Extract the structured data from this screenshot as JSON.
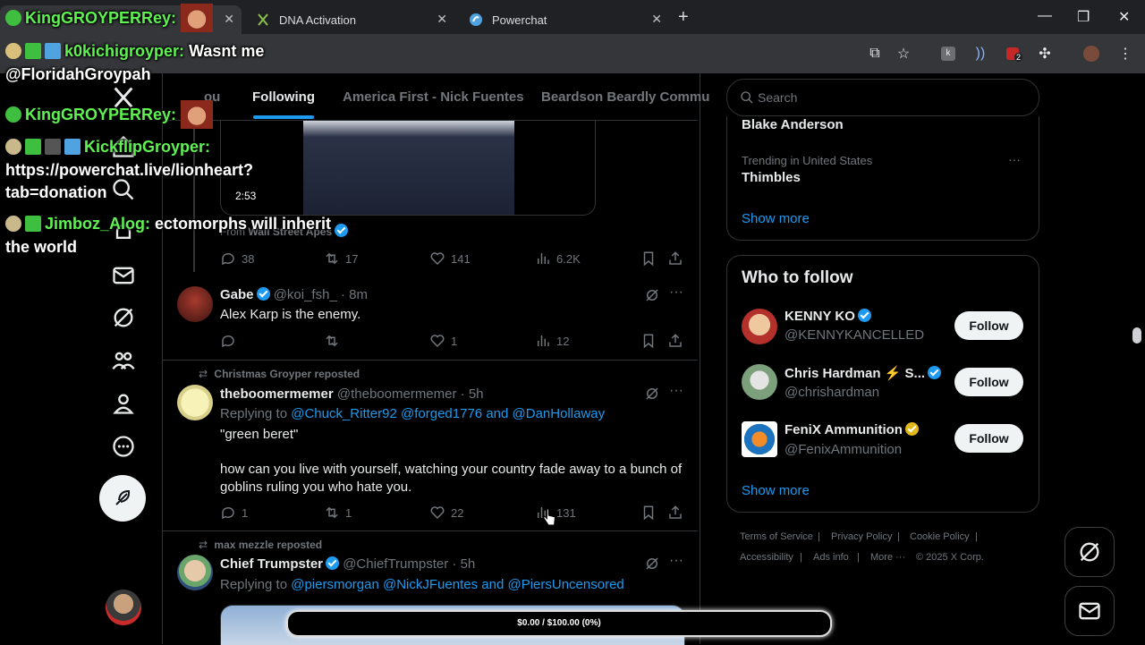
{
  "browser": {
    "tabs": [
      {
        "label": ""
      },
      {
        "label": "DNA Activation"
      },
      {
        "label": "Powerchat"
      }
    ],
    "extension_badge": "2"
  },
  "timeline": {
    "tabs": [
      "ou",
      "Following",
      "America First - Nick Fuentes",
      "Beardson Beardly Commu"
    ],
    "video_post": {
      "duration": "2:53",
      "from_label": "From",
      "from_account": "Wall Street Apes",
      "replies": "38",
      "reposts": "17",
      "likes": "141",
      "views": "6.2K"
    },
    "reply_post": {
      "name": "Gabe",
      "handle": "@koi_fsh_",
      "time": "· 8m",
      "text": "Alex Karp is the enemy.",
      "replies": "",
      "reposts": "",
      "likes": "1",
      "views": "12"
    },
    "boomer_post": {
      "repost_by": "Christmas Groyper reposted",
      "name": "theboomermemer",
      "handle": "@theboomermemer",
      "time": "· 5h",
      "replying_label": "Replying to",
      "reply_to_1": "@Chuck_Ritter92",
      "reply_to_2": "@forged1776",
      "and_label": "and",
      "reply_to_3": "@DanHollaway",
      "line1": "\"green beret\"",
      "line2": "how can you live with yourself, watching your country fade away to a bunch of goblins ruling you who hate you.",
      "replies": "1",
      "reposts": "1",
      "likes": "22",
      "views": "131"
    },
    "trumpster_post": {
      "repost_by": "max mezzle reposted",
      "name": "Chief Trumpster",
      "handle": "@ChiefTrumpster",
      "time": "· 5h",
      "replying_label": "Replying to",
      "reply_to_1": "@piersmorgan",
      "reply_to_2": "@NickJFuentes",
      "and_label": "and",
      "reply_to_3": "@PiersUncensored"
    }
  },
  "sidebar": {
    "search_placeholder": "Search",
    "trend_top": "Blake Anderson",
    "trend_context": "Trending in United States",
    "trend_name": "Thimbles",
    "show_more": "Show more",
    "who_to_follow_title": "Who to follow",
    "suggestions": [
      {
        "name": "KENNY KO",
        "handle": "@KENNYKANCELLED",
        "button": "Follow"
      },
      {
        "name": "Chris Hardman ⚡ S...",
        "handle": "@chrishardman",
        "button": "Follow"
      },
      {
        "name": "FeniX Ammunition",
        "handle": "@FenixAmmunition",
        "button": "Follow"
      }
    ],
    "show_more_2": "Show more",
    "footer": {
      "terms": "Terms of Service",
      "privacy": "Privacy Policy",
      "cookie": "Cookie Policy",
      "accessibility": "Accessibility",
      "ads": "Ads info",
      "more": "More ···",
      "copyright": "© 2025 X Corp."
    }
  },
  "chat": [
    {
      "user": "KingGROYPERRey:",
      "text": ""
    },
    {
      "user": "k0kichigroyper:",
      "text": "Wasnt me"
    },
    {
      "user": "",
      "text": "@FloridahGroypah"
    },
    {
      "user": "KingGROYPERRey:",
      "text": ""
    },
    {
      "user": "KickflipGroyper:",
      "text": ""
    },
    {
      "user": "",
      "text": "https://powerchat.live/lionheart?"
    },
    {
      "user": "",
      "text": "tab=donation"
    },
    {
      "user": "Jimboz_Alog:",
      "text": "ectomorphs will inherit"
    },
    {
      "user": "",
      "text": "the world"
    }
  ],
  "donation": {
    "label": "$0.00 / $100.00 (0%)",
    "progress_percent": 0
  },
  "colors": {
    "accent": "#1d9bf0",
    "chat_user": "#5ff252",
    "background": "#000000"
  }
}
